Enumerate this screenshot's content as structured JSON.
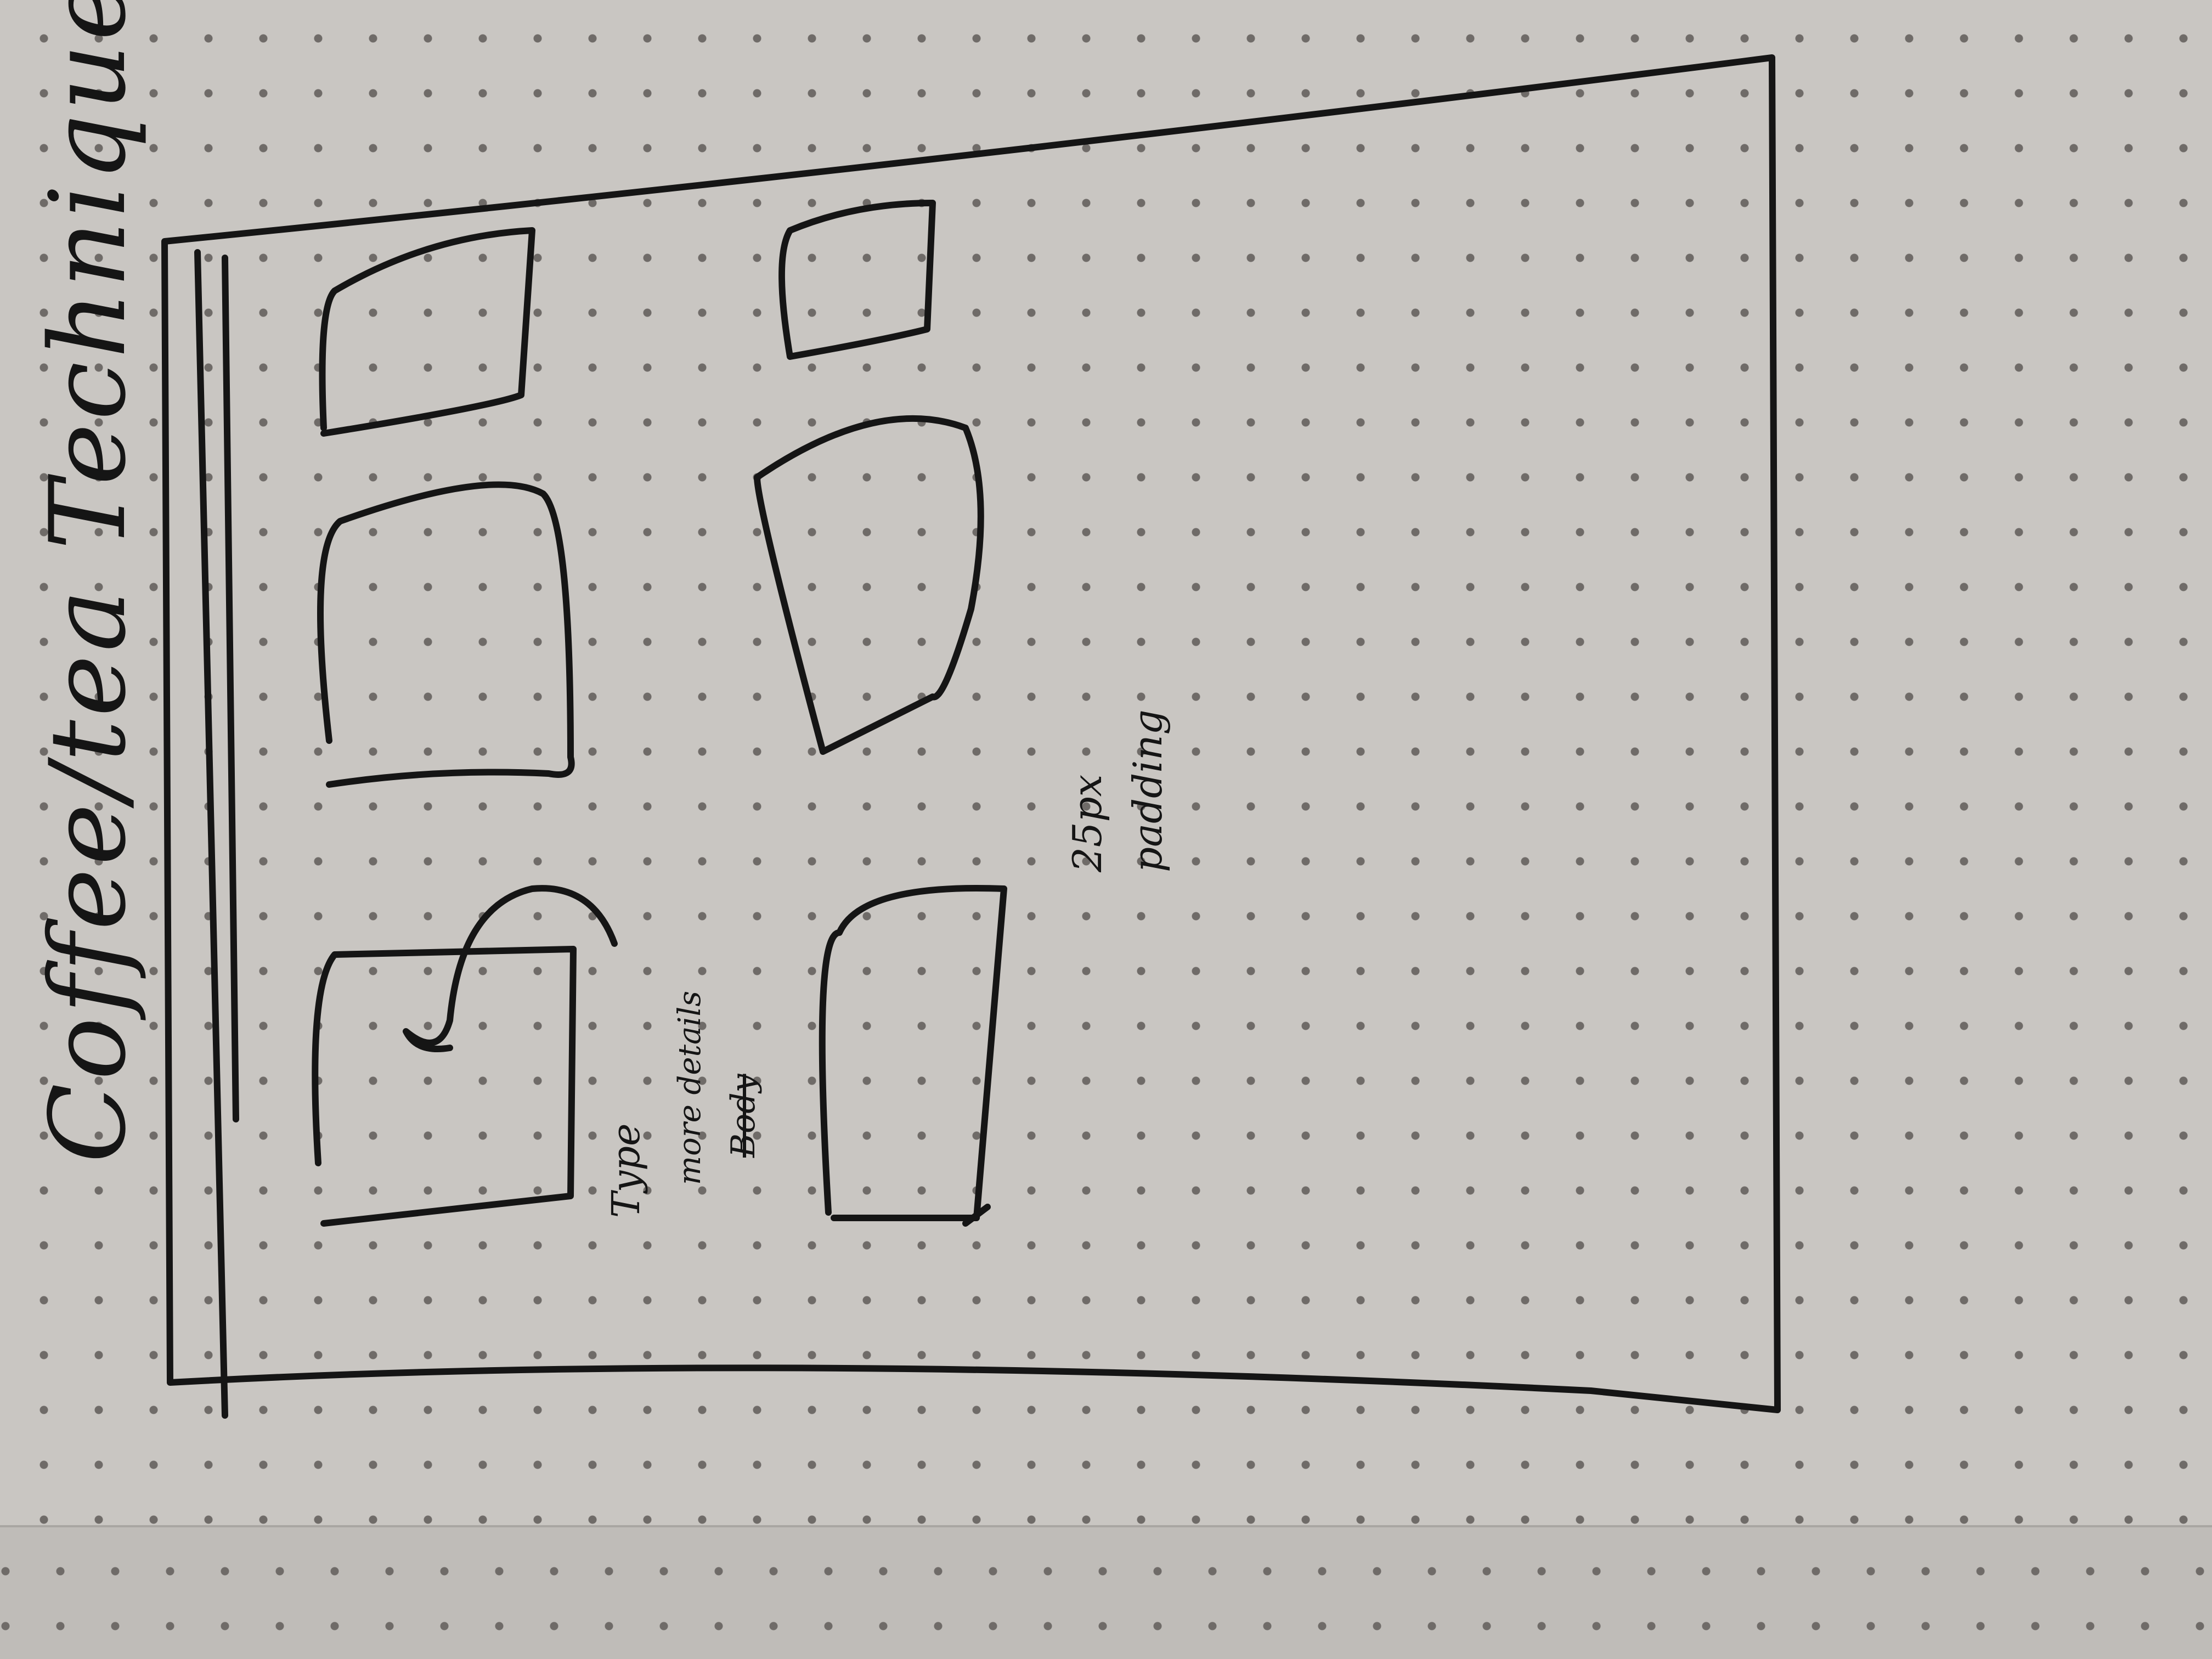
{
  "sketch": {
    "title": "Coffee/tea Techniques",
    "annotations": {
      "type_label": "Type",
      "more_details": "more details",
      "body_struck": "Body",
      "padding_value": "25px",
      "padding_label": "padding"
    }
  }
}
